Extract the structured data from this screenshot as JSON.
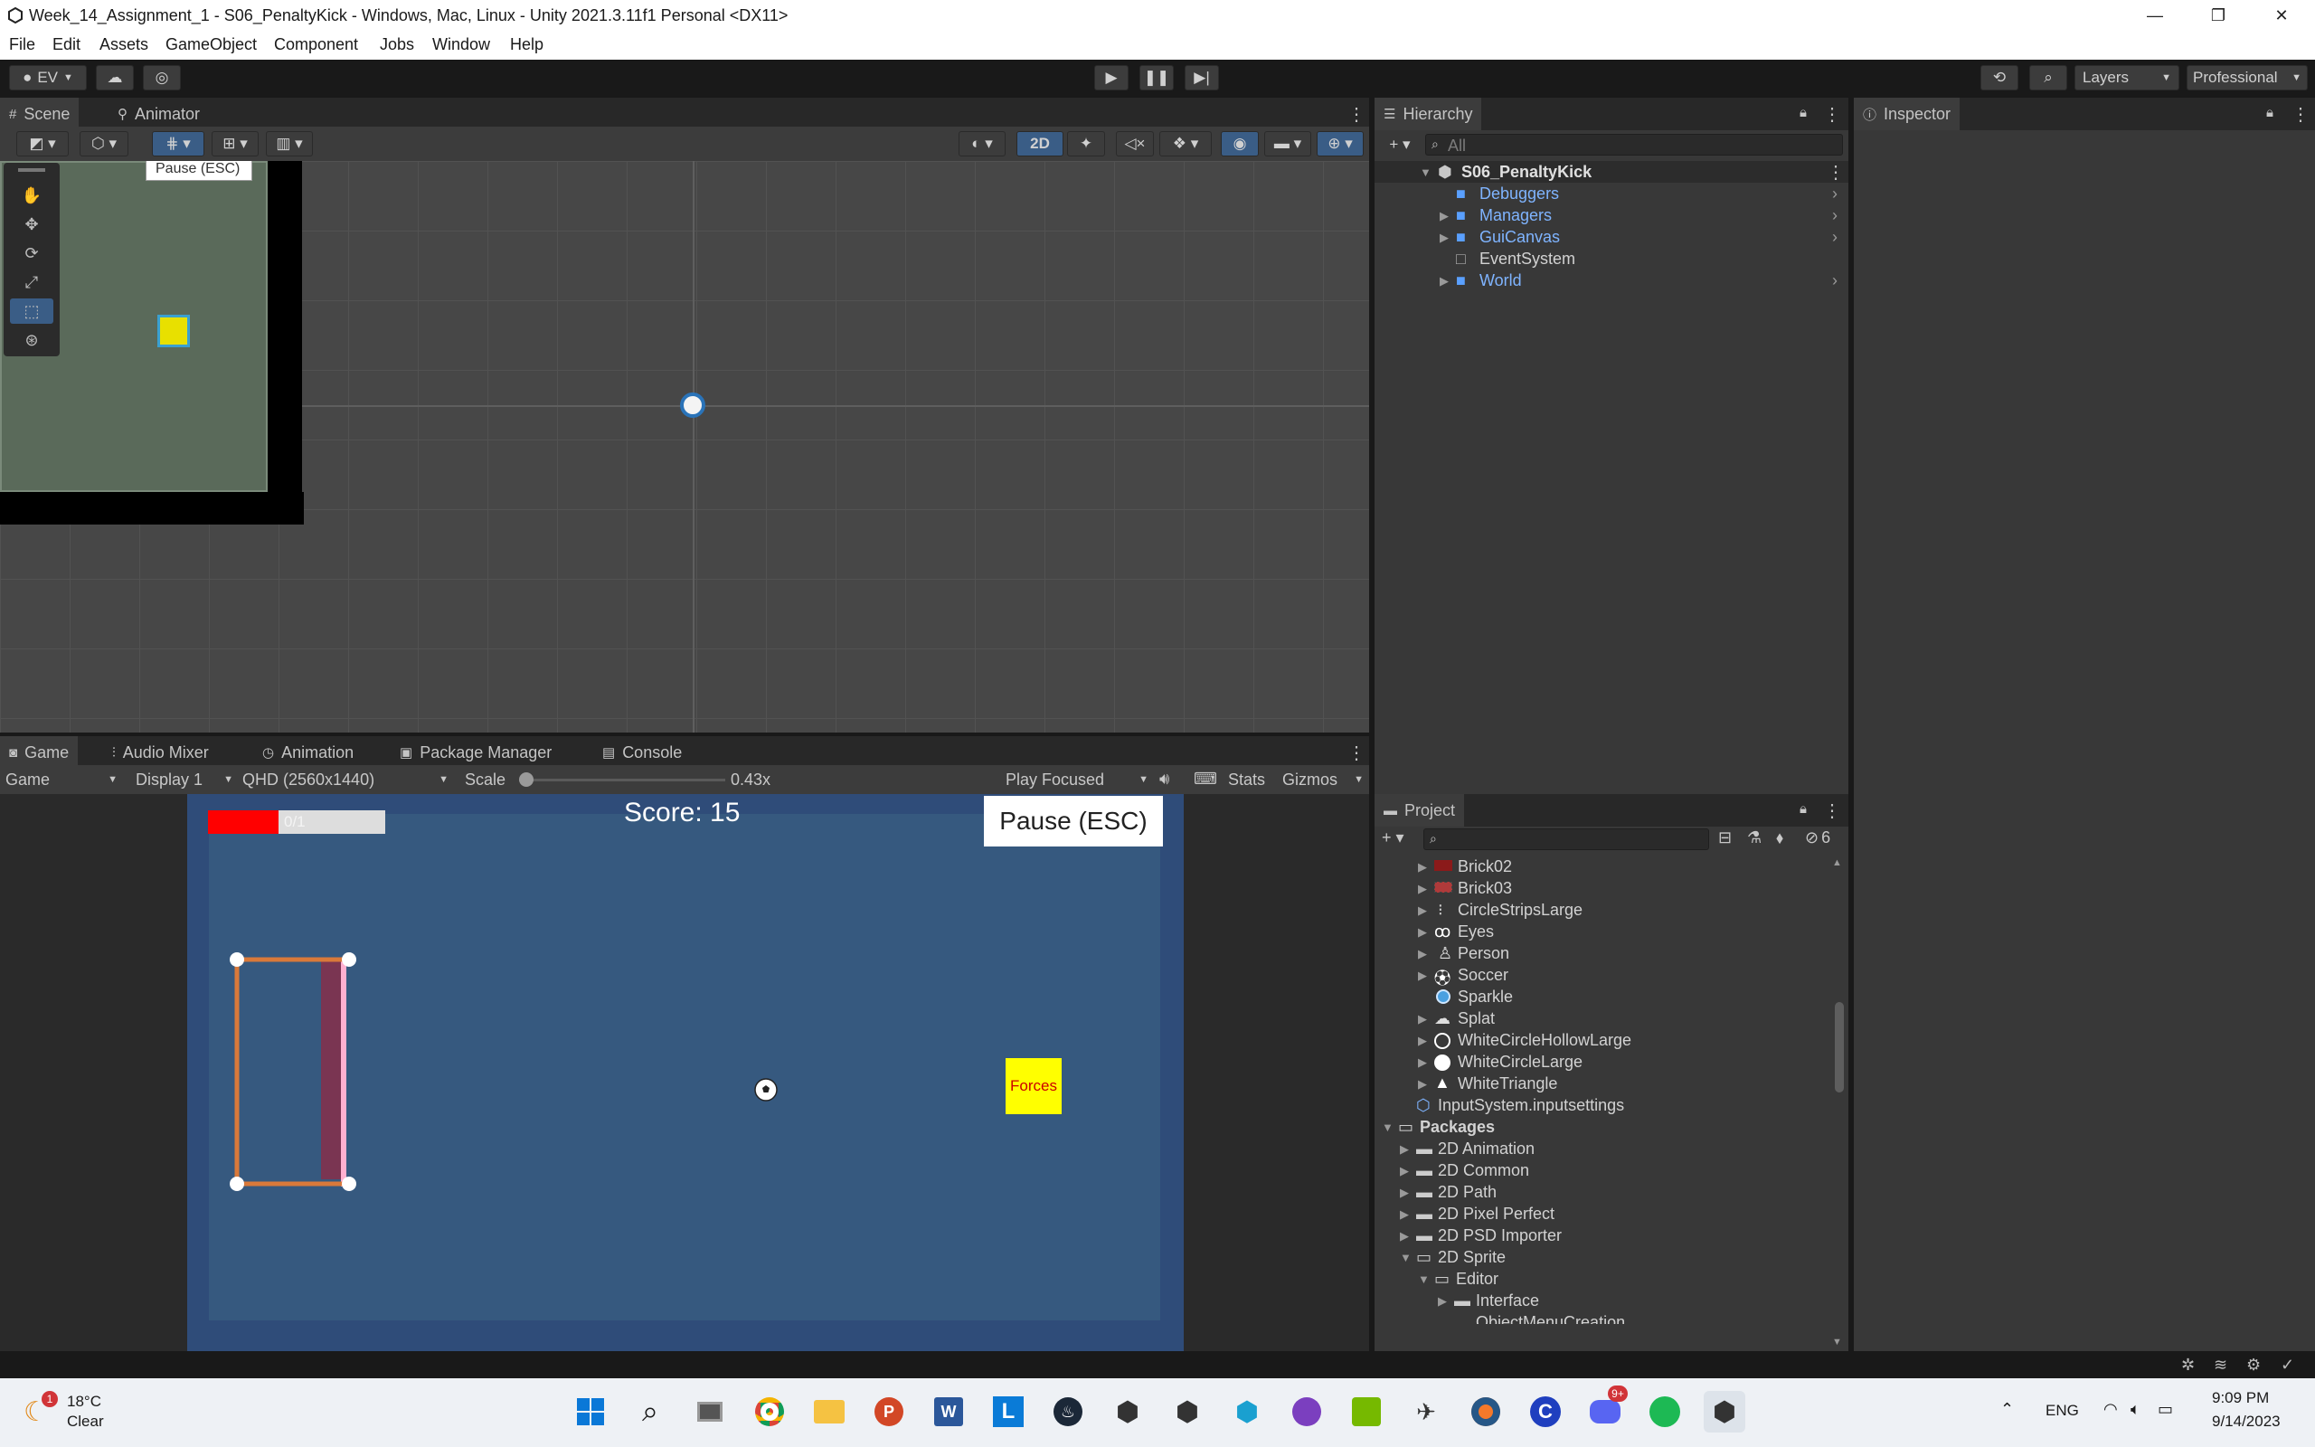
{
  "window": {
    "title": "Week_14_Assignment_1 - S06_PenaltyKick - Windows, Mac, Linux - Unity 2021.3.11f1 Personal <DX11>"
  },
  "menu": [
    "File",
    "Edit",
    "Assets",
    "GameObject",
    "Component",
    "Jobs",
    "Window",
    "Help"
  ],
  "toolbar": {
    "account": "EV",
    "layers": "Layers",
    "layout": "Professional"
  },
  "scene": {
    "tabs": [
      "Scene",
      "Animator"
    ],
    "mode_2d": "2D",
    "tooltip": "Pause (ESC)"
  },
  "hierarchy": {
    "tab": "Hierarchy",
    "search_placeholder": "All",
    "scene_name": "S06_PenaltyKick",
    "items": [
      "Debuggers",
      "Managers",
      "GuiCanvas",
      "EventSystem",
      "World"
    ]
  },
  "inspector": {
    "tab": "Inspector"
  },
  "game": {
    "tabs": [
      "Game",
      "Audio Mixer",
      "Animation",
      "Package Manager",
      "Console"
    ],
    "view_select": "Game",
    "display": "Display 1",
    "resolution": "QHD (2560x1440)",
    "scale_label": "Scale",
    "scale_value": "0.43x",
    "play_mode": "Play Focused",
    "stats": "Stats",
    "gizmos": "Gizmos",
    "progress_text": "0/1",
    "progress_fraction": 0.4,
    "score": "Score: 15",
    "pause_button": "Pause (ESC)",
    "forces_label": "Forces"
  },
  "project": {
    "tab": "Project",
    "hidden_count": "6",
    "assets": [
      "Brick02",
      "Brick03",
      "CircleStripsLarge",
      "Eyes",
      "Person",
      "Soccer",
      "Sparkle",
      "Splat",
      "WhiteCircleHollowLarge",
      "WhiteCircleLarge",
      "WhiteTriangle"
    ],
    "input_settings": "InputSystem.inputsettings",
    "packages_label": "Packages",
    "packages": [
      "2D Animation",
      "2D Common",
      "2D Path",
      "2D Pixel Perfect",
      "2D PSD Importer",
      "2D Sprite"
    ],
    "editor_folder": "Editor",
    "interface_folder": "Interface",
    "cut_off_item": "ObjectMenuCreation"
  },
  "taskbar": {
    "weather_temp": "18°C",
    "weather_desc": "Clear",
    "weather_badge": "1",
    "discord_badge": "9+",
    "language": "ENG",
    "time": "9:09 PM",
    "date": "9/14/2023"
  },
  "colors": {
    "unity_bg": "#383838",
    "prefab_blue": "#7fb4ff",
    "game_field": "#36597f",
    "progress_red": "#ff0000",
    "goal_orange": "#d9793a",
    "forces_yellow": "#ffff00"
  }
}
